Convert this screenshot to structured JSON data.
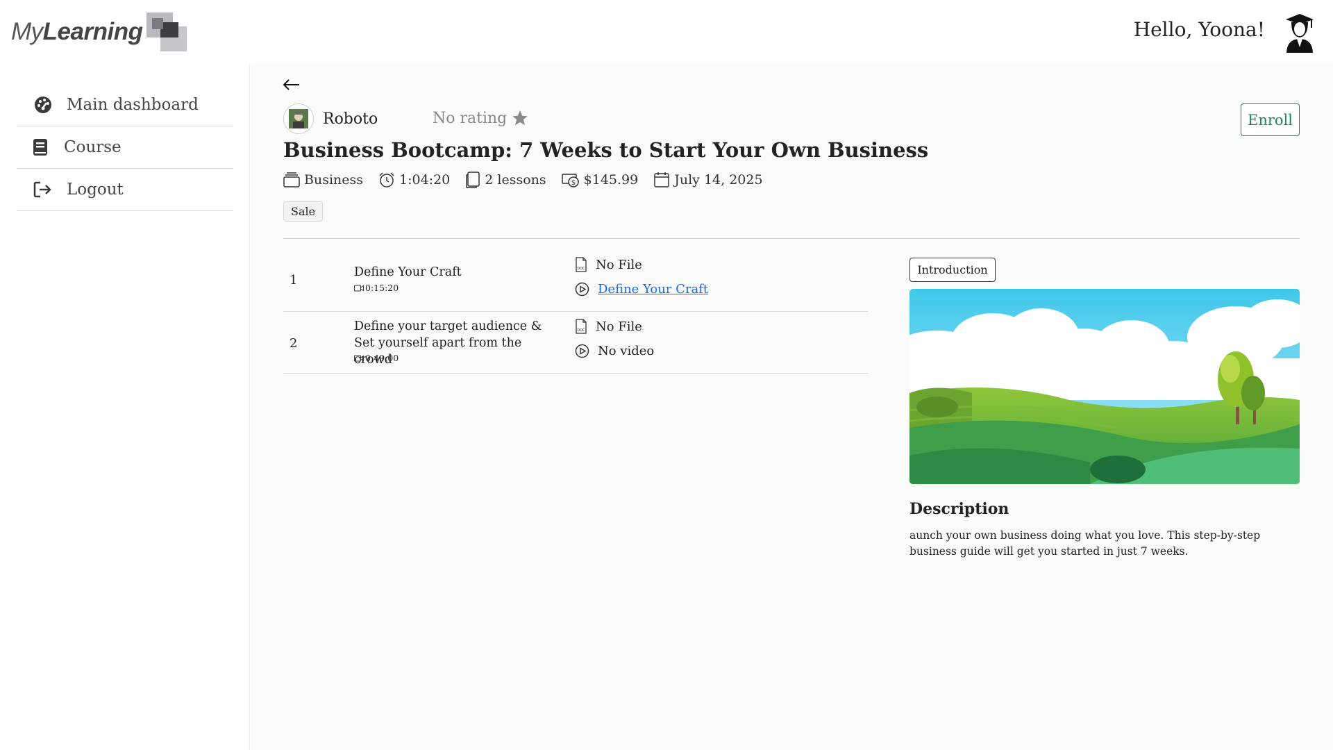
{
  "header": {
    "logo_text_my": "My",
    "logo_text_learning": "Learning",
    "greeting": "Hello, Yoona!"
  },
  "sidebar": {
    "items": [
      {
        "label": "Main dashboard",
        "icon": "dashboard-icon"
      },
      {
        "label": "Course",
        "icon": "book-icon"
      },
      {
        "label": "Logout",
        "icon": "logout-icon"
      }
    ]
  },
  "course": {
    "author": "Roboto",
    "rating": "No rating",
    "enroll_label": "Enroll",
    "title": "Business Bootcamp: 7 Weeks to Start Your Own Business",
    "category": "Business",
    "duration": "1:04:20",
    "lessons_count": "2 lessons",
    "price": "$145.99",
    "date": "July 14, 2025",
    "tag": "Sale"
  },
  "lessons": [
    {
      "number": "1",
      "title": "Define Your Craft",
      "duration": "0:15:20",
      "file": "No File",
      "video": "Define Your Craft",
      "video_is_link": true
    },
    {
      "number": "2",
      "title": "Define your target audience & Set yourself apart from the crowd",
      "duration": "0:49:00",
      "file": "No File",
      "video": "No video",
      "video_is_link": false
    }
  ],
  "preview": {
    "intro_label": "Introduction",
    "description_heading": "Description",
    "description_text": "aunch your own business doing what you love. This step-by-step business guide will get you started in just 7 weeks."
  },
  "colors": {
    "enroll_accent": "#198754",
    "link": "#0d6efd",
    "main_bg": "#fafafa"
  }
}
